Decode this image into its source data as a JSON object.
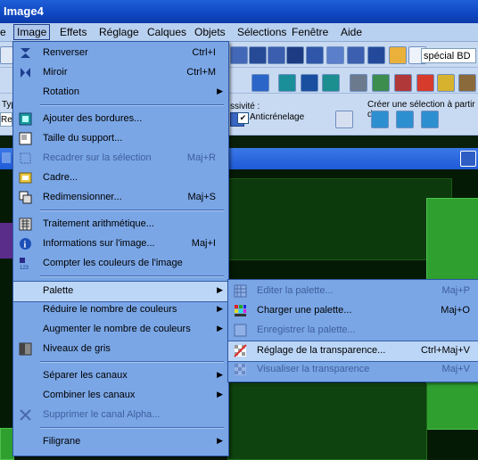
{
  "window": {
    "title": "Image4"
  },
  "menubar": [
    {
      "label": "e"
    },
    {
      "label": "Image"
    },
    {
      "label": "Effets"
    },
    {
      "label": "Réglage"
    },
    {
      "label": "Calques"
    },
    {
      "label": "Objets"
    },
    {
      "label": "Sélections"
    },
    {
      "label": "Fenêtre"
    },
    {
      "label": "Aide"
    }
  ],
  "toolbar": {
    "special_value": "spécial BD",
    "partial_label": "ssivité :",
    "antialias_label": "Anticrénelage",
    "selection_label": "Créer une sélection à partir de",
    "left_partial_1": "Typ",
    "left_partial_2": "Re"
  },
  "image_menu": {
    "items": [
      {
        "label": "Renverser",
        "shortcut": "Ctrl+I",
        "icon": "flip-vertical-icon"
      },
      {
        "label": "Miroir",
        "shortcut": "Ctrl+M",
        "icon": "mirror-icon"
      },
      {
        "label": "Rotation",
        "icon": "none"
      },
      {
        "label": "Ajouter des bordures...",
        "icon": "add-borders-icon"
      },
      {
        "label": "Taille du support...",
        "icon": "canvas-size-icon"
      },
      {
        "label": "Recadrer sur la sélection",
        "shortcut": "Maj+R",
        "icon": "crop-icon",
        "disabled": true
      },
      {
        "label": "Cadre...",
        "icon": "frame-icon"
      },
      {
        "label": "Redimensionner...",
        "shortcut": "Maj+S",
        "icon": "resize-icon"
      },
      {
        "label": "Traitement arithmétique...",
        "icon": "arithmetic-icon"
      },
      {
        "label": "Informations sur l'image...",
        "shortcut": "Maj+I",
        "icon": "info-icon"
      },
      {
        "label": "Compter les couleurs de l'image",
        "icon": "count-colors-icon"
      },
      {
        "label": "Palette",
        "icon": "none"
      },
      {
        "label": "Réduire le nombre de couleurs",
        "icon": "none"
      },
      {
        "label": "Augmenter le nombre de couleurs",
        "icon": "none"
      },
      {
        "label": "Niveaux de gris",
        "icon": "greyscale-icon"
      },
      {
        "label": "Séparer les canaux",
        "icon": "none"
      },
      {
        "label": "Combiner les canaux",
        "icon": "none"
      },
      {
        "label": "Supprimer le canal Alpha...",
        "icon": "delete-alpha-icon",
        "disabled": true
      },
      {
        "label": "Filigrane",
        "icon": "none"
      }
    ]
  },
  "palette_menu": {
    "items": [
      {
        "label": "Editer la palette...",
        "shortcut": "Maj+P",
        "icon": "edit-palette-icon",
        "disabled": true
      },
      {
        "label": "Charger une palette...",
        "shortcut": "Maj+O",
        "icon": "load-palette-icon"
      },
      {
        "label": "Enregistrer la palette...",
        "icon": "save-palette-icon",
        "disabled": true
      },
      {
        "label": "Réglage de la transparence...",
        "shortcut": "Ctrl+Maj+V",
        "icon": "transparency-settings-icon"
      },
      {
        "label": "Visualiser la transparence",
        "shortcut": "Maj+V",
        "icon": "view-transparency-icon",
        "disabled": true
      }
    ]
  },
  "colors": {
    "menu_bg": "#7aa6e6",
    "highlight": "#bcd6f7",
    "titlebar": "#1f5fd8",
    "canvas_green": "#2fa02f"
  }
}
